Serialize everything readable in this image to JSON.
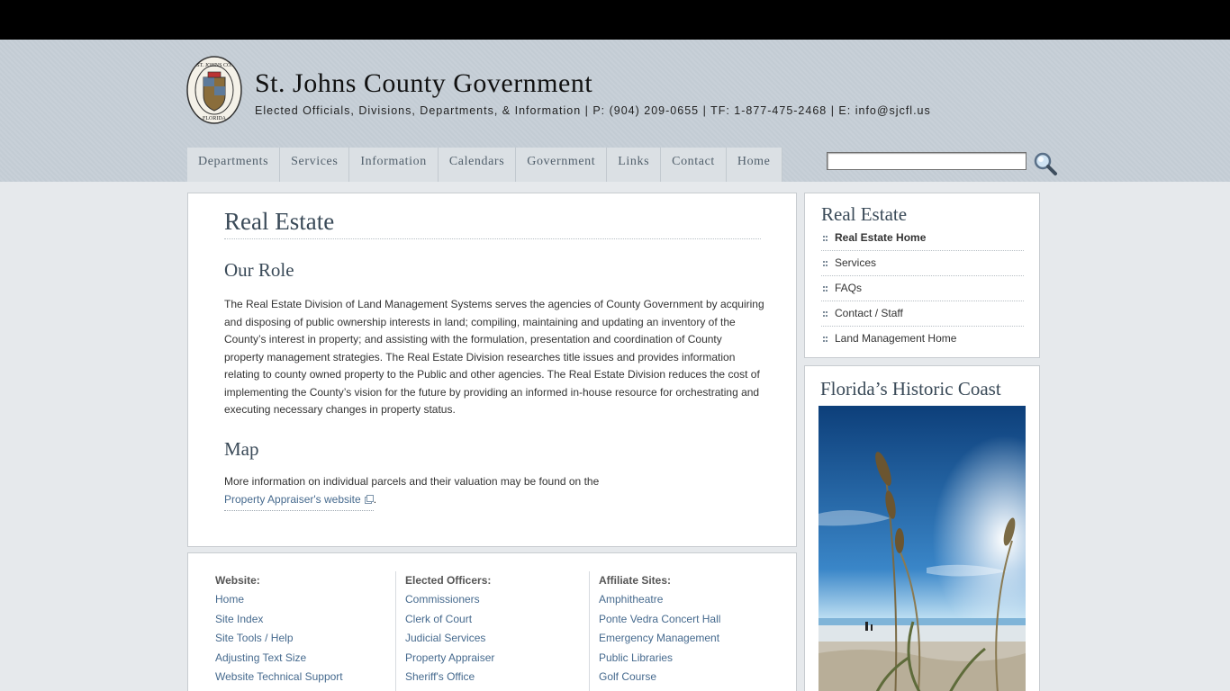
{
  "site": {
    "title": "St. Johns County Government",
    "subtitle": "Elected Officials, Divisions, Departments, & Information  |  P: (904) 209-0655  |  TF: 1-877-475-2468  |  E: info@sjcfl.us"
  },
  "nav": [
    {
      "label": "Departments"
    },
    {
      "label": "Services"
    },
    {
      "label": "Information"
    },
    {
      "label": "Calendars"
    },
    {
      "label": "Government"
    },
    {
      "label": "Links"
    },
    {
      "label": "Contact"
    },
    {
      "label": "Home"
    }
  ],
  "search": {
    "value": "",
    "icon": "magnifier-icon"
  },
  "main": {
    "title": "Real Estate",
    "role_heading": "Our Role",
    "role_text": "The Real Estate Division of Land Management Systems serves the agencies of County Government by acquiring and disposing of public ownership interests in land; compiling, maintaining and updating an inventory of the County’s interest in property; and assisting with the formulation, presentation and coordination of County property management strategies. The Real Estate Division researches title issues and provides information relating to county owned property to the Public and other agencies. The Real Estate Division reduces the cost of implementing the County’s vision for the future by providing an informed in-house resource for orchestrating and executing necessary changes in property status.",
    "map_heading": "Map",
    "map_text": "More information on individual parcels and their valuation may be found on the",
    "map_link": "Property Appraiser's website",
    "map_suffix": "."
  },
  "sidebar": {
    "title": "Real Estate",
    "items": [
      {
        "label": "Real Estate Home"
      },
      {
        "label": "Services"
      },
      {
        "label": "FAQs"
      },
      {
        "label": "Contact / Staff"
      },
      {
        "label": "Land Management Home"
      }
    ],
    "promo_title": "Florida’s Historic Coast"
  },
  "footer": {
    "columns": [
      {
        "heading": "Website:",
        "items": [
          "Home",
          "Site Index",
          "Site Tools / Help",
          "Adjusting Text Size",
          "Website Technical Support"
        ]
      },
      {
        "heading": "Elected Officers:",
        "items": [
          "Commissioners",
          "Clerk of Court",
          "Judicial Services",
          "Property Appraiser",
          "Sheriff's Office"
        ]
      },
      {
        "heading": "Affiliate Sites:",
        "items": [
          "Amphitheatre",
          "Ponte Vedra Concert Hall",
          "Emergency Management",
          "Public Libraries",
          "Golf Course"
        ]
      }
    ]
  },
  "colors": {
    "accent": "#466a8e",
    "heading": "#3a4a58",
    "topbar": "#000000"
  }
}
